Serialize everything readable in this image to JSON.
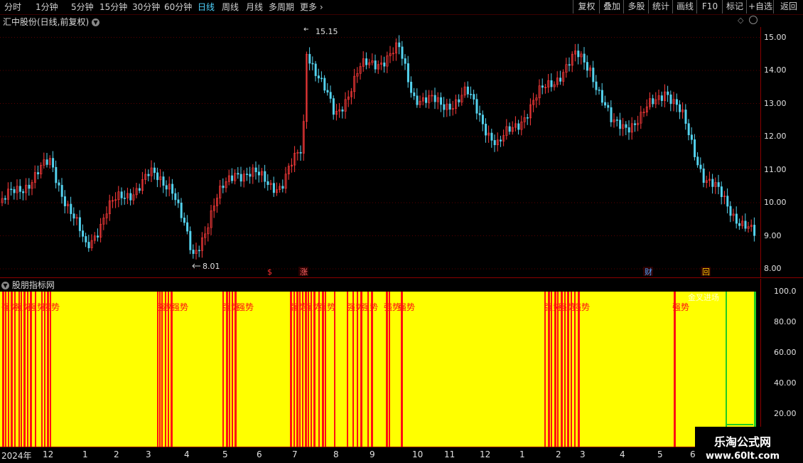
{
  "toolbar": {
    "periods": [
      "分时",
      "1分钟",
      "5分钟",
      "15分钟",
      "30分钟",
      "60分钟",
      "日线",
      "周线",
      "月线",
      "多周期",
      "更多"
    ],
    "active_period": "日线",
    "right_buttons": [
      "复权",
      "叠加",
      "多股",
      "统计",
      "画线",
      "F10",
      "标记",
      "+自选",
      "返回"
    ]
  },
  "main_chart": {
    "title": "汇中股份(日线,前复权)",
    "high_label": "15.15",
    "low_label": "8.01",
    "event_markers": [
      {
        "text": "$",
        "color": "#ff3333"
      },
      {
        "text": "涨",
        "color": "#ff6666"
      },
      {
        "text": "财",
        "color": "#4fa3ff"
      },
      {
        "text": "回",
        "color": "#ffcc00"
      }
    ],
    "y_ticks": [
      "15.00",
      "14.00",
      "13.00",
      "12.00",
      "11.00",
      "10.00",
      "9.00",
      "8.00"
    ],
    "colors": {
      "up": "#ff3b3b",
      "down": "#54d2ee",
      "grid": "#5a0000"
    }
  },
  "sub_chart": {
    "title": "股朋指标网",
    "label_text": "强势",
    "yellow_label": "金叉进场",
    "y_ticks": [
      "100.0",
      "80.00",
      "60.00",
      "40.00",
      "20.00"
    ],
    "colors": {
      "fill": "#ffff00",
      "signal": "#ff1010",
      "green": "#22cc22"
    }
  },
  "x_axis": {
    "labels": [
      "2024年",
      "12",
      "1",
      "2",
      "3",
      "4",
      "5",
      "6",
      "7",
      "8",
      "9",
      "10",
      "11",
      "12",
      "1",
      "2",
      "3",
      "4",
      "5",
      "6"
    ]
  },
  "watermark": {
    "line1": "乐淘公式网",
    "line2": "www.60lt.com"
  }
}
